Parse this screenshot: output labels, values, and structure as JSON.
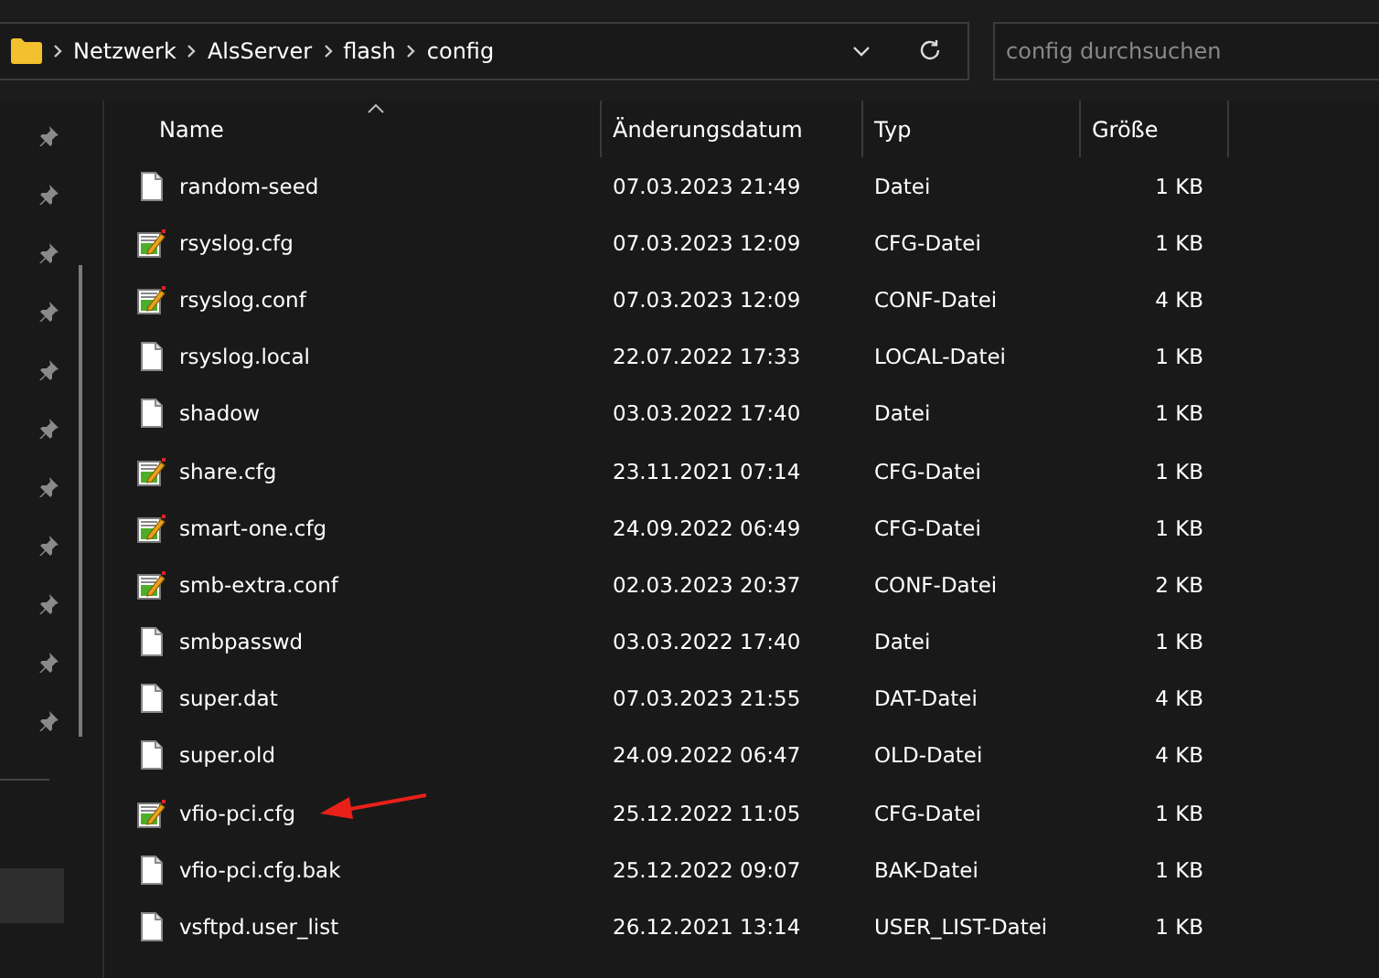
{
  "address_bar": {
    "path": [
      "Netzwerk",
      "AlsServer",
      "flash",
      "config"
    ]
  },
  "search": {
    "placeholder": "config durchsuchen"
  },
  "table": {
    "columns": [
      {
        "label": "Name",
        "sorted": true
      },
      {
        "label": "Änderungsdatum",
        "sorted": false
      },
      {
        "label": "Typ",
        "sorted": false
      },
      {
        "label": "Größe",
        "sorted": false
      }
    ],
    "rows": [
      {
        "kind": "plain",
        "name": "random-seed",
        "date": "07.03.2023 21:49",
        "type": "Datei",
        "size": "1 KB",
        "marked": false
      },
      {
        "kind": "text",
        "name": "rsyslog.cfg",
        "date": "07.03.2023 12:09",
        "type": "CFG-Datei",
        "size": "1 KB",
        "marked": false
      },
      {
        "kind": "text",
        "name": "rsyslog.conf",
        "date": "07.03.2023 12:09",
        "type": "CONF-Datei",
        "size": "4 KB",
        "marked": false
      },
      {
        "kind": "plain",
        "name": "rsyslog.local",
        "date": "22.07.2022 17:33",
        "type": "LOCAL-Datei",
        "size": "1 KB",
        "marked": false
      },
      {
        "kind": "plain",
        "name": "shadow",
        "date": "03.03.2022 17:40",
        "type": "Datei",
        "size": "1 KB",
        "marked": false
      },
      {
        "kind": "text",
        "name": "share.cfg",
        "date": "23.11.2021 07:14",
        "type": "CFG-Datei",
        "size": "1 KB",
        "marked": false
      },
      {
        "kind": "text",
        "name": "smart-one.cfg",
        "date": "24.09.2022 06:49",
        "type": "CFG-Datei",
        "size": "1 KB",
        "marked": false
      },
      {
        "kind": "text",
        "name": "smb-extra.conf",
        "date": "02.03.2023 20:37",
        "type": "CONF-Datei",
        "size": "2 KB",
        "marked": false
      },
      {
        "kind": "plain",
        "name": "smbpasswd",
        "date": "03.03.2022 17:40",
        "type": "Datei",
        "size": "1 KB",
        "marked": false
      },
      {
        "kind": "plain",
        "name": "super.dat",
        "date": "07.03.2023 21:55",
        "type": "DAT-Datei",
        "size": "4 KB",
        "marked": false
      },
      {
        "kind": "plain",
        "name": "super.old",
        "date": "24.09.2022 06:47",
        "type": "OLD-Datei",
        "size": "4 KB",
        "marked": false
      },
      {
        "kind": "text",
        "name": "vfio-pci.cfg",
        "date": "25.12.2022 11:05",
        "type": "CFG-Datei",
        "size": "1 KB",
        "marked": true
      },
      {
        "kind": "plain",
        "name": "vfio-pci.cfg.bak",
        "date": "25.12.2022 09:07",
        "type": "BAK-Datei",
        "size": "1 KB",
        "marked": false
      },
      {
        "kind": "plain",
        "name": "vsftpd.user_list",
        "date": "26.12.2021 13:14",
        "type": "USER_LIST-Datei",
        "size": "1 KB",
        "marked": false
      }
    ]
  }
}
